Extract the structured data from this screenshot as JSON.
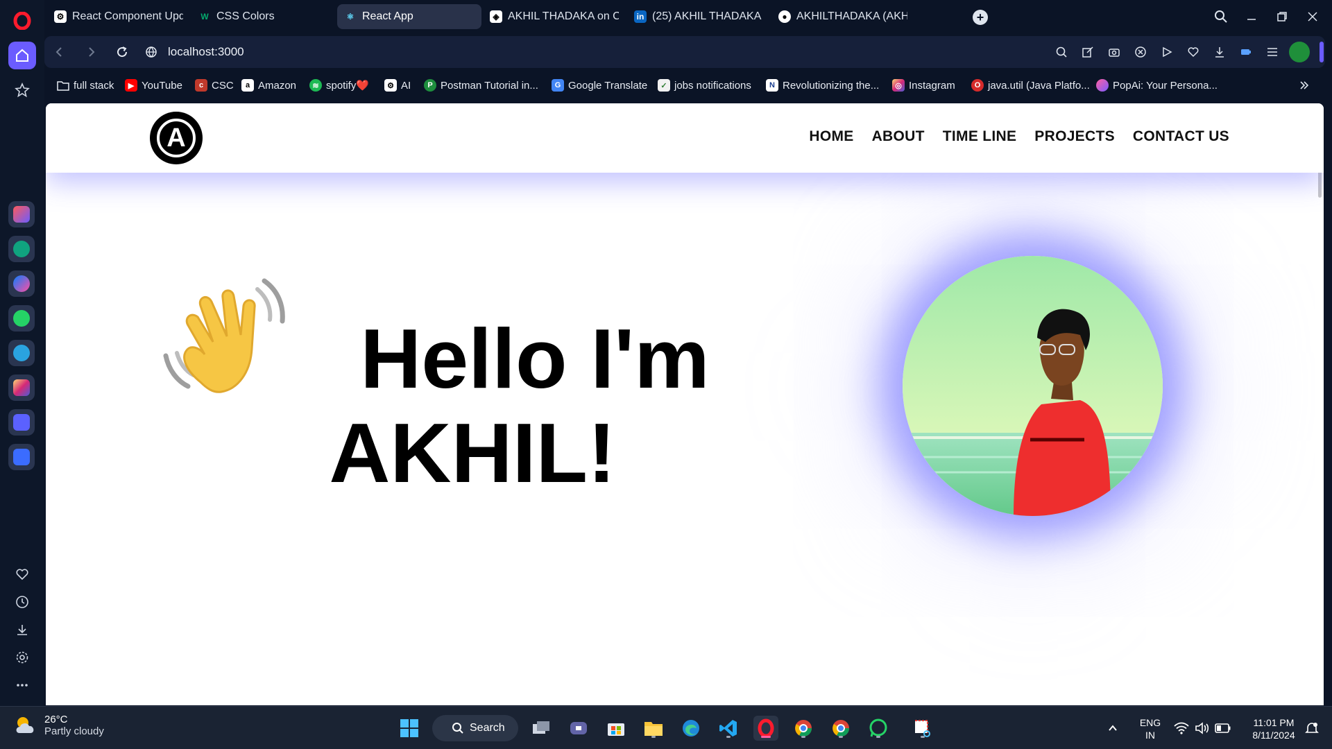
{
  "browser": {
    "tabs": [
      {
        "title": "React Component Update",
        "icon": "chatgpt-icon"
      },
      {
        "title": "CSS Colors",
        "icon": "w3schools-icon"
      },
      {
        "title": "React App",
        "icon": "react-icon",
        "active": true
      },
      {
        "title": "AKHIL THADAKA on Codep",
        "icon": "codepen-icon"
      },
      {
        "title": "(25) AKHIL THADAKA | Lin",
        "icon": "linkedin-icon"
      },
      {
        "title": "AKHILTHADAKA (AKHIL TH",
        "icon": "github-icon"
      }
    ],
    "url": "localhost:3000",
    "bookmarks": [
      {
        "label": "full stack",
        "icon": "folder-icon"
      },
      {
        "label": "YouTube",
        "icon": "youtube-icon"
      },
      {
        "label": "CSC",
        "icon": "csc-icon"
      },
      {
        "label": "Amazon",
        "icon": "amazon-icon"
      },
      {
        "label": "spotify❤️",
        "icon": "spotify-icon"
      },
      {
        "label": "AI",
        "icon": "chatgpt-icon"
      },
      {
        "label": "Postman Tutorial in...",
        "icon": "postman-icon"
      },
      {
        "label": "Google Translate",
        "icon": "google-translate-icon"
      },
      {
        "label": "jobs notifications",
        "icon": "jobs-icon"
      },
      {
        "label": "Revolutionizing the...",
        "icon": "news-icon"
      },
      {
        "label": "Instagram",
        "icon": "instagram-icon"
      },
      {
        "label": "java.util (Java Platfo...",
        "icon": "oracle-icon"
      },
      {
        "label": "PopAi: Your Persona...",
        "icon": "popai-icon"
      }
    ]
  },
  "site": {
    "logo_letter": "A",
    "nav": [
      "HOME",
      "ABOUT",
      "TIME LINE",
      "PROJECTS",
      "CONTACT US"
    ],
    "hero": {
      "line1": "Hello I'm",
      "line2": "AKHIL!"
    }
  },
  "taskbar": {
    "weather_temp": "26°C",
    "weather_cond": "Partly cloudy",
    "search_label": "Search",
    "lang1": "ENG",
    "lang2": "IN",
    "time": "11:01 PM",
    "date": "8/11/2024"
  },
  "colors": {
    "browser_bg": "#0b1426",
    "header_glow": "#7878ff",
    "photo_glow": "#8282ff"
  }
}
